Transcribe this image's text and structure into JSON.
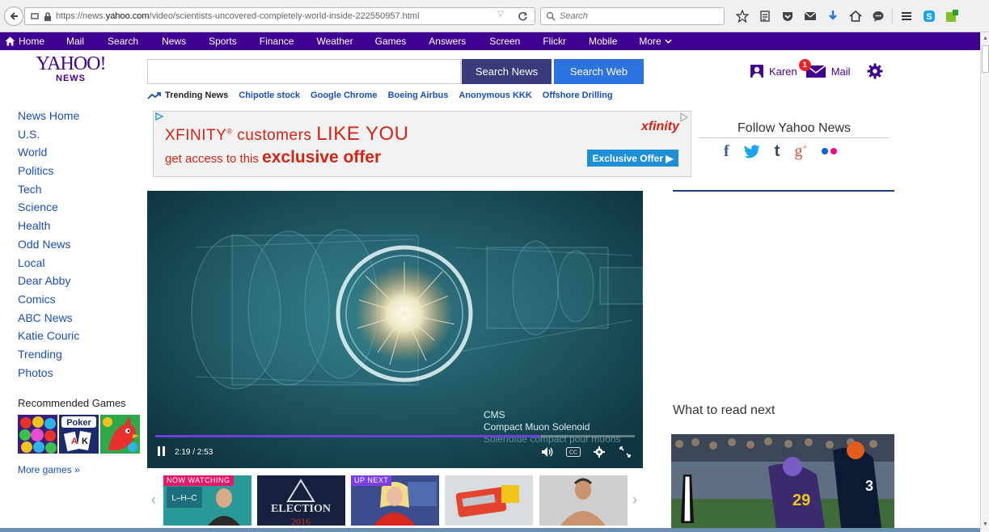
{
  "browser": {
    "url_prefix": "https://news.",
    "url_domain": "yahoo.com",
    "url_path": "/video/scientists-uncovered-completely-world-inside-222550957.html",
    "search_placeholder": "Search"
  },
  "nav": {
    "items": [
      "Home",
      "Mail",
      "Search",
      "News",
      "Sports",
      "Finance",
      "Weather",
      "Games",
      "Answers",
      "Screen",
      "Flickr",
      "Mobile",
      "More"
    ]
  },
  "logo": {
    "line1": "YAHOO!",
    "line2": "NEWS"
  },
  "search": {
    "value": "",
    "news_button": "Search News",
    "web_button": "Search Web"
  },
  "trending": {
    "label": "Trending News",
    "links": [
      "Chipotle stock",
      "Google Chrome",
      "Boeing Airbus",
      "Anonymous KKK",
      "Offshore Drilling"
    ]
  },
  "user": {
    "name": "Karen",
    "mail_label": "Mail",
    "mail_count": "1"
  },
  "sidebar": {
    "links": [
      "News Home",
      "U.S.",
      "World",
      "Politics",
      "Tech",
      "Science",
      "Health",
      "Odd News",
      "Local",
      "Dear Abby",
      "Comics",
      "ABC News",
      "Katie Couric",
      "Trending",
      "Photos"
    ],
    "games_title": "Recommended Games",
    "more_games": "More games »"
  },
  "ad": {
    "line1_prefix": "XFINITY",
    "line1_mark": "®",
    "line1_middle": " customers ",
    "line1_big": "LIKE YOU",
    "line2_prefix": "get access to this ",
    "line2_bold": "exclusive offer",
    "brand": "xfinity",
    "button": "Exclusive Offer ▶"
  },
  "follow": {
    "title": "Follow Yahoo News",
    "icons": [
      "facebook-icon",
      "twitter-icon",
      "tumblr-icon",
      "google-plus-icon",
      "flickr-icon"
    ]
  },
  "video": {
    "caption_line1": "CMS",
    "caption_line2": "Compact Muon Solenoid",
    "caption_line3": "Solénoïde compact pour muons",
    "time": "2:19 / 2:53",
    "progress": 0.805
  },
  "thumbnails": {
    "badges": [
      "NOW WATCHING",
      "UP NEXT"
    ],
    "thumb1_text": "L–H–C",
    "thumb2_text": "ELECTION",
    "thumb2_year": "2016"
  },
  "read_next": {
    "title": "What to read next",
    "jersey1": "29",
    "jersey2": "3"
  },
  "colors": {
    "yahoo_purple": "#400090",
    "link_blue": "#1a4fb5",
    "search_news": "#3b3a7a",
    "search_web": "#2d73df",
    "ad_red": "#d32415"
  }
}
